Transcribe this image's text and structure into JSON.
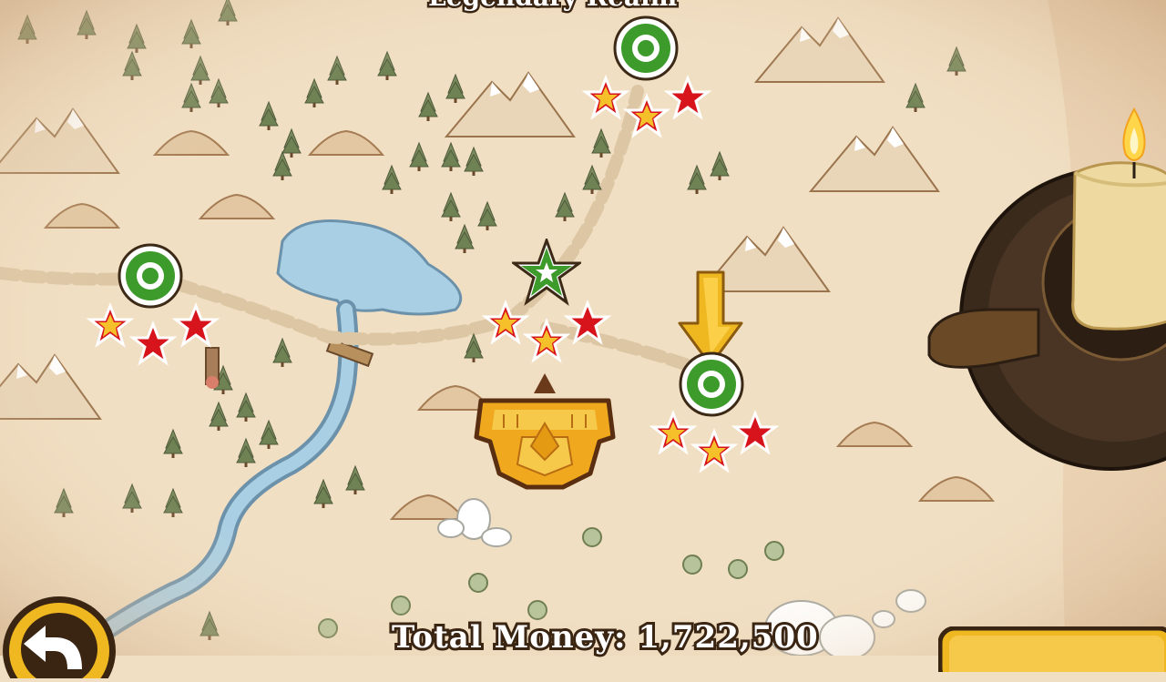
{
  "screen": {
    "title_partial": "Legendary Realm"
  },
  "footer": {
    "money_label": "Total Money:",
    "money_value": "1,722,500",
    "back_icon": "return-arrow-icon",
    "right_button_icon": "gold-button"
  },
  "levels": [
    {
      "name": "level-node-west",
      "state": "completed",
      "stars": 2
    },
    {
      "name": "level-node-north",
      "state": "completed",
      "stars": 2
    },
    {
      "name": "level-node-center",
      "state": "completed-star",
      "stars": 2
    },
    {
      "name": "level-node-current",
      "state": "current",
      "stars": 2
    }
  ],
  "colors": {
    "parchment": "#f1dfc3",
    "river": "#a9cfe4",
    "node_green": "#3c9b2a",
    "star_gold": "#f5c02a",
    "star_red": "#d7141b",
    "arrow_gold": "#f0b820"
  },
  "icons": {
    "current_level_marker": "down-arrow-icon",
    "tower": "golden-fortress-icon",
    "candle": "candle-icon"
  }
}
